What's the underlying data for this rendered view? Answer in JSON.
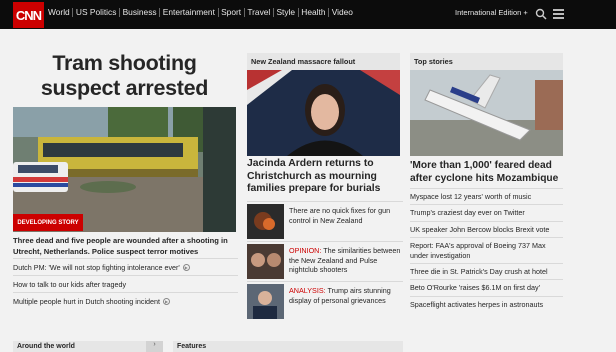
{
  "header": {
    "logo": "CNN",
    "nav": [
      "World",
      "US Politics",
      "Business",
      "Entertainment",
      "Sport",
      "Travel",
      "Style",
      "Health",
      "Video"
    ],
    "edition": "International Edition +"
  },
  "lead": {
    "headline": "Tram shooting suspect arrested",
    "badge": "DEVELOPING STORY",
    "caption": "Three dead and five people are wounded after a shooting in Utrecht, Netherlands. Police suspect terror motives",
    "links": [
      "Dutch PM: 'We will not stop fighting intolerance ever'",
      "How to talk to our kids after tragedy",
      "Multiple people hurt in Dutch shooting incident"
    ]
  },
  "nz": {
    "header": "New Zealand massacre fallout",
    "caption": "Jacinda Ardern returns to Christchurch as mourning families prepare for burials",
    "items": [
      {
        "label": "",
        "text": "There are no quick fixes for gun control in New Zealand"
      },
      {
        "label": "OPINION:",
        "text": " The similarities between the New Zealand and Pulse nightclub shooters"
      },
      {
        "label": "ANALYSIS:",
        "text": " Trump airs stunning display of personal grievances"
      }
    ]
  },
  "top": {
    "header": "Top stories",
    "caption": "'More than 1,000' feared dead after cyclone hits Mozambique",
    "items": [
      "Myspace lost 12 years' worth of music",
      "Trump's craziest day ever on Twitter",
      "UK speaker John Bercow blocks Brexit vote",
      "Report: FAA's approval of Boeing 737 Max under investigation",
      "Three die in St. Patrick's Day crush at hotel",
      "Beto O'Rourke 'raises $6.1M on first day'",
      "Spaceflight activates herpes in astronauts"
    ]
  },
  "bottom": {
    "left": "Around the world",
    "right": "Features"
  },
  "colors": {
    "brand_red": "#cc0000",
    "topbar": "#0c0c0c",
    "page_bg": "#f2f2f2"
  },
  "icons": [
    "search-icon",
    "menu-icon",
    "play-icon",
    "chevron-right-icon"
  ]
}
